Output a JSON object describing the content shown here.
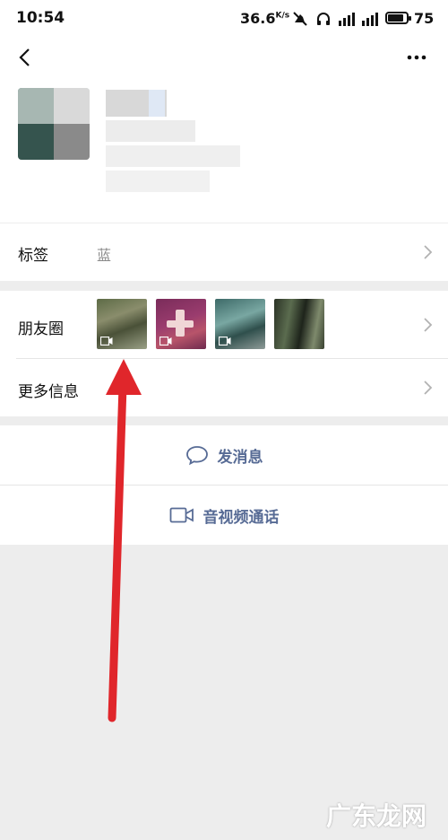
{
  "status_bar": {
    "time": "10:54",
    "network_speed": "36.6",
    "network_unit": "K/s",
    "battery": "75"
  },
  "profile": {
    "tag_label": "标签",
    "tag_value": "蓝",
    "moments_label": "朋友圈",
    "more_info_label": "更多信息"
  },
  "actions": {
    "send_message": "发消息",
    "av_call": "音视频通话"
  },
  "watermark": "广东龙网",
  "colors": {
    "link_blue": "#576b95",
    "arrow_red": "#e0262b",
    "background": "#ededed"
  }
}
